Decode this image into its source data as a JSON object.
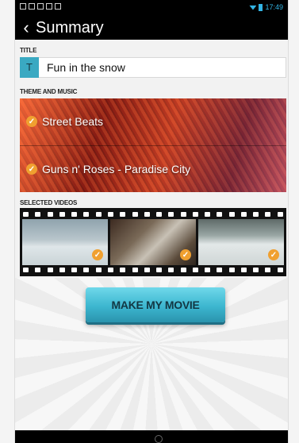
{
  "action_bar": {
    "title": "Summary"
  },
  "status_bar": {
    "time": "17:49"
  },
  "title_section": {
    "label": "TITLE",
    "badge": "T",
    "value": "Fun in the snow"
  },
  "theme_section": {
    "label": "THEME AND MUSIC",
    "items": [
      {
        "label": "Street Beats",
        "checked": true
      },
      {
        "label": "Guns n' Roses - Paradise City",
        "checked": true
      }
    ]
  },
  "videos_section": {
    "label": "SELECTED VIDEOS",
    "count": 3
  },
  "make_button": {
    "label": "MAKE MY MOVIE"
  },
  "colors": {
    "accent": "#3aa9c2",
    "check": "#f0a030",
    "button": "#3cb6cf"
  }
}
